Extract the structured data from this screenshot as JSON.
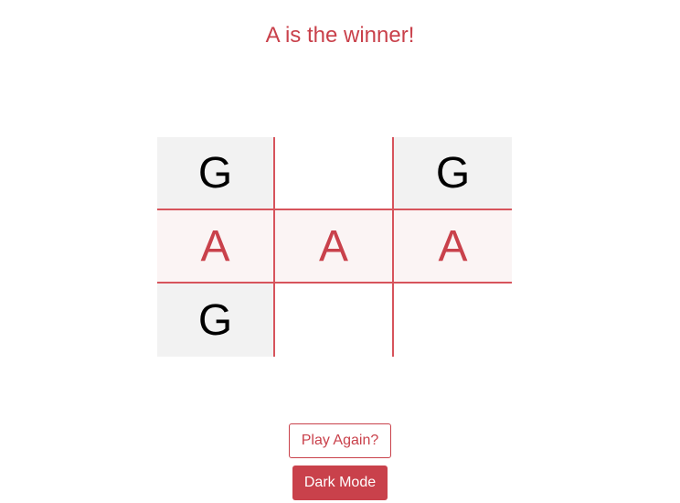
{
  "status": {
    "message": "A is the winner!"
  },
  "board": {
    "cells": [
      [
        "G",
        "",
        "G"
      ],
      [
        "A",
        "A",
        "A"
      ],
      [
        "G",
        "",
        ""
      ]
    ],
    "winning_row": 1
  },
  "buttons": {
    "play_again": "Play Again?",
    "dark_mode": "Dark Mode"
  },
  "colors": {
    "accent": "#c9414b",
    "grid_line": "#d7545c",
    "marked_cell_bg": "#f2f2f2",
    "winning_cell_bg": "#fbf4f4"
  }
}
